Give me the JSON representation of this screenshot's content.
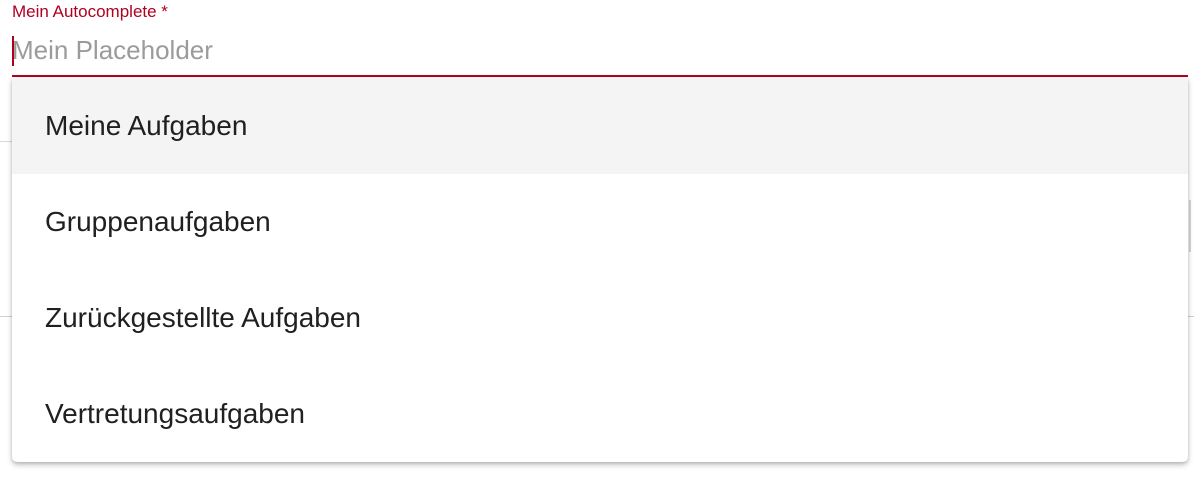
{
  "field": {
    "label": "Mein Autocomplete *",
    "placeholder": "Mein Placeholder",
    "value": "",
    "accent_color": "#b00020"
  },
  "dropdown": {
    "options": [
      {
        "label": "Meine Aufgaben",
        "highlighted": true
      },
      {
        "label": "Gruppenaufgaben",
        "highlighted": false
      },
      {
        "label": "Zurückgestellte Aufgaben",
        "highlighted": false
      },
      {
        "label": "Vertretungsaufgaben",
        "highlighted": false
      }
    ],
    "highlight_color": "#f4f4f4"
  }
}
